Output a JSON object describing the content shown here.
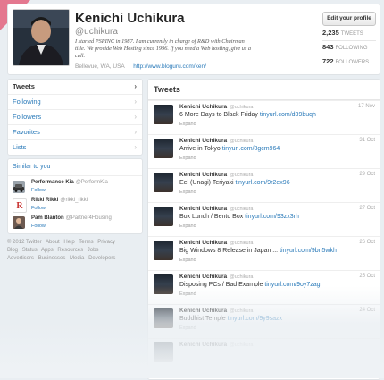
{
  "profile": {
    "name": "Kenichi Uchikura",
    "handle": "@uchikura",
    "bio": "I started PSPINC in 1987. I am currently in charge of R&D with Chairman title. We provide Web Hosting since 1996. If you need a Web hosting, give us a call.",
    "location": "Bellevue, WA, USA",
    "website": "http://www.bloguru.com/ken/",
    "edit_label": "Edit your profile",
    "stats": [
      {
        "value": "2,235",
        "label": "TWEETS"
      },
      {
        "value": "843",
        "label": "FOLLOWING"
      },
      {
        "value": "722",
        "label": "FOLLOWERS"
      }
    ]
  },
  "nav": {
    "items": [
      {
        "label": "Tweets"
      },
      {
        "label": "Following"
      },
      {
        "label": "Followers"
      },
      {
        "label": "Favorites"
      },
      {
        "label": "Lists"
      }
    ],
    "chevron": "›"
  },
  "suggestions": {
    "heading": "Similar to you",
    "items": [
      {
        "name": "Performance Kia",
        "handle": "@PerformKia",
        "follow": "Follow",
        "icon": "car-dealer-avatar",
        "color": "#9aa3ab"
      },
      {
        "name": "Rikki Rikki",
        "handle": "@rikki_rikki",
        "follow": "Follow",
        "icon": "restaurant-logo-avatar",
        "color": "#c8312f"
      },
      {
        "name": "Pam Blanton",
        "handle": "@Partner4Housing",
        "follow": "Follow",
        "icon": "person-avatar",
        "color": "#6d5a50"
      }
    ]
  },
  "footer": {
    "links": [
      "© 2012 Twitter",
      "About",
      "Help",
      "Terms",
      "Privacy",
      "Blog",
      "Status",
      "Apps",
      "Resources",
      "Jobs",
      "Advertisers",
      "Businesses",
      "Media",
      "Developers"
    ]
  },
  "timeline": {
    "title": "Tweets",
    "tweets": [
      {
        "name": "Kenichi Uchikura",
        "handle": "@uchikura",
        "date": "17 Nov",
        "text": "6 More Days to Black Friday ",
        "link": "tinyurl.com/d39buqh",
        "expand": "Expand"
      },
      {
        "name": "Kenichi Uchikura",
        "handle": "@uchikura",
        "date": "31 Oct",
        "text": "Arrive in Tokyo ",
        "link": "tinyurl.com/8gcm964",
        "expand": "Expand"
      },
      {
        "name": "Kenichi Uchikura",
        "handle": "@uchikura",
        "date": "29 Oct",
        "text": "Eel (Unagi) Teriyaki ",
        "link": "tinyurl.com/9r2ex96",
        "expand": "Expand"
      },
      {
        "name": "Kenichi Uchikura",
        "handle": "@uchikura",
        "date": "27 Oct",
        "text": "Box Lunch / Bento Box ",
        "link": "tinyurl.com/93zx3rh",
        "expand": "Expand"
      },
      {
        "name": "Kenichi Uchikura",
        "handle": "@uchikura",
        "date": "26 Oct",
        "text": "Big Windows 8 Release in Japan ... ",
        "link": "tinyurl.com/9bn5wkh",
        "expand": "Expand"
      },
      {
        "name": "Kenichi Uchikura",
        "handle": "@uchikura",
        "date": "25 Oct",
        "text": "Disposing PCs / Bad Example ",
        "link": "tinyurl.com/9oy7zag",
        "expand": "Expand"
      },
      {
        "name": "Kenichi Uchikura",
        "handle": "@uchikura",
        "date": "24 Oct",
        "text": "Buddhist Temple ",
        "link": "tinyurl.com/9y9sazx",
        "expand": "Expand"
      },
      {
        "name": "Kenichi Uchikura",
        "handle": "@uchikura",
        "date": "",
        "text": "",
        "link": "",
        "expand": ""
      }
    ]
  },
  "colors": {
    "accent": "#2a7ab9",
    "ribbon": "#e4788f",
    "background": "#e9eef2"
  }
}
